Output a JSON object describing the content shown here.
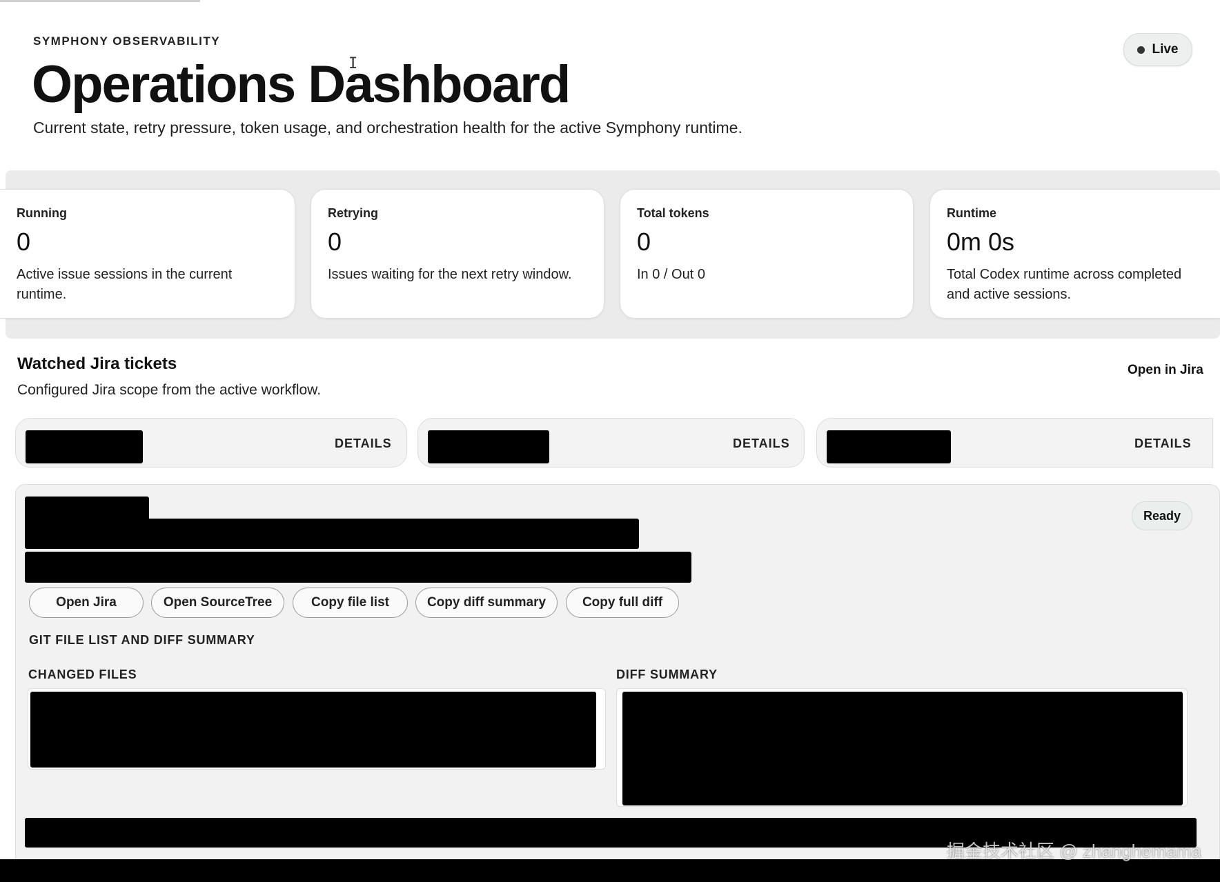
{
  "header": {
    "eyebrow": "SYMPHONY OBSERVABILITY",
    "title": "Operations Dashboard",
    "subtitle": "Current state, retry pressure, token usage, and orchestration health for the active Symphony runtime.",
    "live_label": "Live"
  },
  "stats": [
    {
      "label": "Running",
      "value": "0",
      "description": "Active issue sessions in the current runtime."
    },
    {
      "label": "Retrying",
      "value": "0",
      "description": "Issues waiting for the next retry window."
    },
    {
      "label": "Total tokens",
      "value": "0",
      "description": "In 0 / Out 0"
    },
    {
      "label": "Runtime",
      "value": "0m 0s",
      "description": "Total Codex runtime across completed and active sessions."
    }
  ],
  "tickets_section": {
    "title": "Watched Jira tickets",
    "subtitle": "Configured Jira scope from the active workflow.",
    "open_link": "Open in Jira",
    "ticket_details_label": "DETAILS"
  },
  "detail": {
    "status": "Ready",
    "actions": [
      "Open Jira",
      "Open SourceTree",
      "Copy file list",
      "Copy diff summary",
      "Copy full diff"
    ],
    "git_heading": "GIT FILE LIST AND DIFF SUMMARY",
    "changed_files_heading": "CHANGED FILES",
    "diff_summary_heading": "DIFF SUMMARY"
  },
  "watermark": "掘金技术社区 @ zhanghemama"
}
